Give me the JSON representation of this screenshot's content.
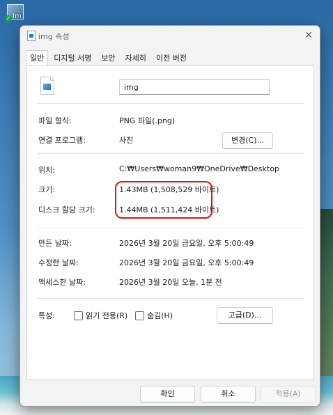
{
  "desktop": {
    "icon_label": "Im"
  },
  "dialog": {
    "title": "img 속성",
    "close_glyph": "✕",
    "tabs": [
      "일반",
      "디지털 서명",
      "보안",
      "자세히",
      "이전 버전"
    ],
    "file_name": "img",
    "rows": {
      "type_label": "파일 형식:",
      "type_value": "PNG 파일(.png)",
      "opens_label": "연결 프로그램:",
      "opens_value": "사진",
      "change_button": "변경(C)...",
      "location_label": "위치:",
      "location_value": "C:₩Users₩woman9₩OneDrive₩Desktop",
      "size_label": "크기:",
      "size_value": "1.43MB (1,508,529 바이트)",
      "disk_size_label": "디스크 할당 크기:",
      "disk_size_value": "1.44MB (1,511,424 바이트)",
      "created_label": "만든 날짜:",
      "created_value": "2026년 3월 20일 금요일, 오후 5:00:49",
      "modified_label": "수정한 날짜:",
      "modified_value": "2026년 3월 20일 금요일, 오후 5:00:49",
      "accessed_label": "액세스한 날짜:",
      "accessed_value": "2026년 3월 20일 오늘, 1분 전",
      "attributes_label": "특성:",
      "readonly_label": "읽기 전용(R)",
      "hidden_label": "숨김(H)",
      "advanced_button": "고급(D)..."
    },
    "buttons": {
      "ok": "확인",
      "cancel": "취소",
      "apply": "적용(A)"
    },
    "highlight_color": "#e01010"
  }
}
